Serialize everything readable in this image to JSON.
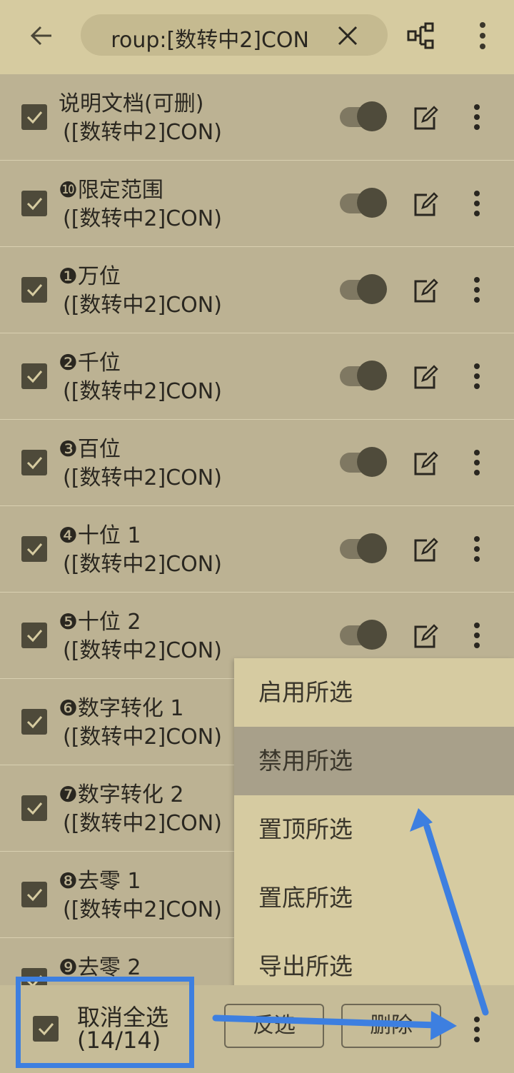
{
  "toolbar": {
    "search_query": "roup:[数转中2]CON",
    "icons": {
      "back": "arrow-left-icon",
      "clear": "close-icon",
      "group": "group-tree-icon",
      "more": "more-vertical-icon"
    }
  },
  "rules": [
    {
      "title": "说明文档(可删)",
      "group": "([数转中2]CON)",
      "checked": true,
      "enabled": true
    },
    {
      "title": "❿限定范围",
      "group": "([数转中2]CON)",
      "checked": true,
      "enabled": true
    },
    {
      "title": "❶万位",
      "group": "([数转中2]CON)",
      "checked": true,
      "enabled": true
    },
    {
      "title": "❷千位",
      "group": "([数转中2]CON)",
      "checked": true,
      "enabled": true
    },
    {
      "title": "❸百位",
      "group": "([数转中2]CON)",
      "checked": true,
      "enabled": true
    },
    {
      "title": "❹十位 1",
      "group": "([数转中2]CON)",
      "checked": true,
      "enabled": true
    },
    {
      "title": "❺十位 2",
      "group": "([数转中2]CON)",
      "checked": true,
      "enabled": true
    },
    {
      "title": "❻数字转化 1",
      "group": "([数转中2]CON)",
      "checked": true
    },
    {
      "title": "❼数字转化 2",
      "group": "([数转中2]CON)",
      "checked": true
    },
    {
      "title": "❽去零 1",
      "group": "([数转中2]CON)",
      "checked": true
    },
    {
      "title": "❾去零 2",
      "group": "",
      "checked": true
    }
  ],
  "popup_menu": {
    "items": [
      "启用所选",
      "禁用所选",
      "置顶所选",
      "置底所选",
      "导出所选"
    ],
    "highlighted": "禁用所选"
  },
  "bottom_bar": {
    "select_label": "取消全选",
    "count": "(14/14)",
    "invert_label": "反选",
    "delete_label": "删除"
  },
  "colors": {
    "accent_annotation": "#3d7fe0",
    "toolbar_bg": "#d6cba0",
    "list_bg": "#bcb293",
    "checkbox": "#4e4a3a"
  }
}
